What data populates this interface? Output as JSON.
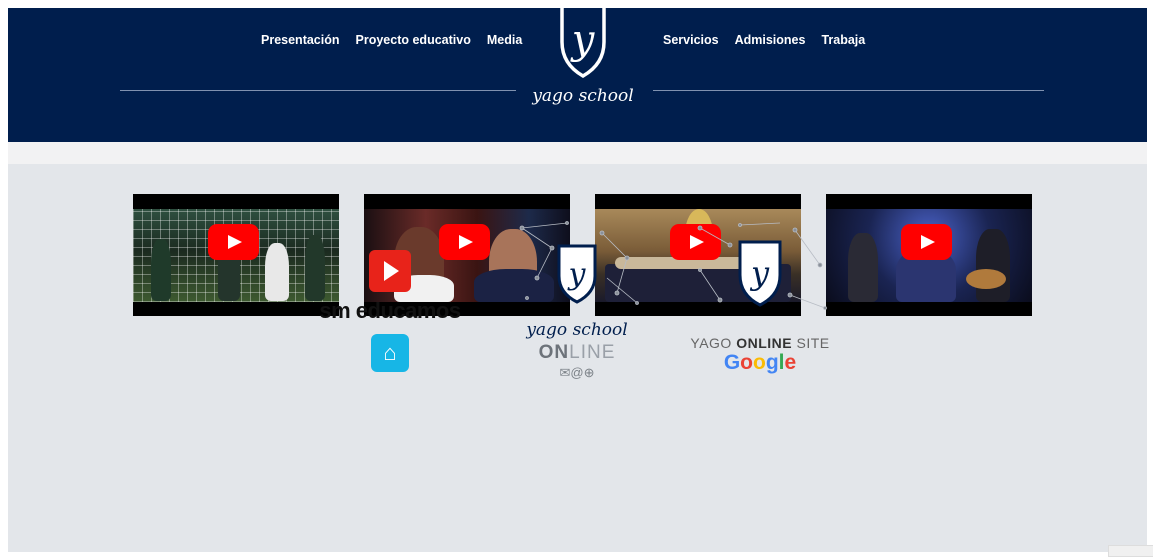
{
  "header": {
    "nav_left": [
      "Presentación",
      "Proyecto educativo",
      "Media"
    ],
    "nav_right": [
      "Servicios",
      "Admisiones",
      "Trabaja"
    ],
    "brand": "yago school",
    "logo_letter": "y",
    "bg_color": "#001e4d"
  },
  "videos": [
    {
      "name": "video-1",
      "icon": "youtube-play-icon"
    },
    {
      "name": "video-2",
      "icon": "youtube-play-icon"
    },
    {
      "name": "video-3",
      "icon": "youtube-play-icon"
    },
    {
      "name": "video-4",
      "icon": "youtube-play-icon"
    }
  ],
  "logos": {
    "sm": {
      "text": "sm educamos"
    },
    "online": {
      "brand": "yago school",
      "on": "ON",
      "line": "LINE",
      "icons": "✉@⊕"
    },
    "site": {
      "label_prefix": "YAGO ",
      "label_bold": "ONLINE",
      "label_suffix": " SITE",
      "google": "Google"
    }
  },
  "colors": {
    "accent": "#001e4d",
    "youtube": "#ff0000",
    "background": "#e3e6ea"
  }
}
